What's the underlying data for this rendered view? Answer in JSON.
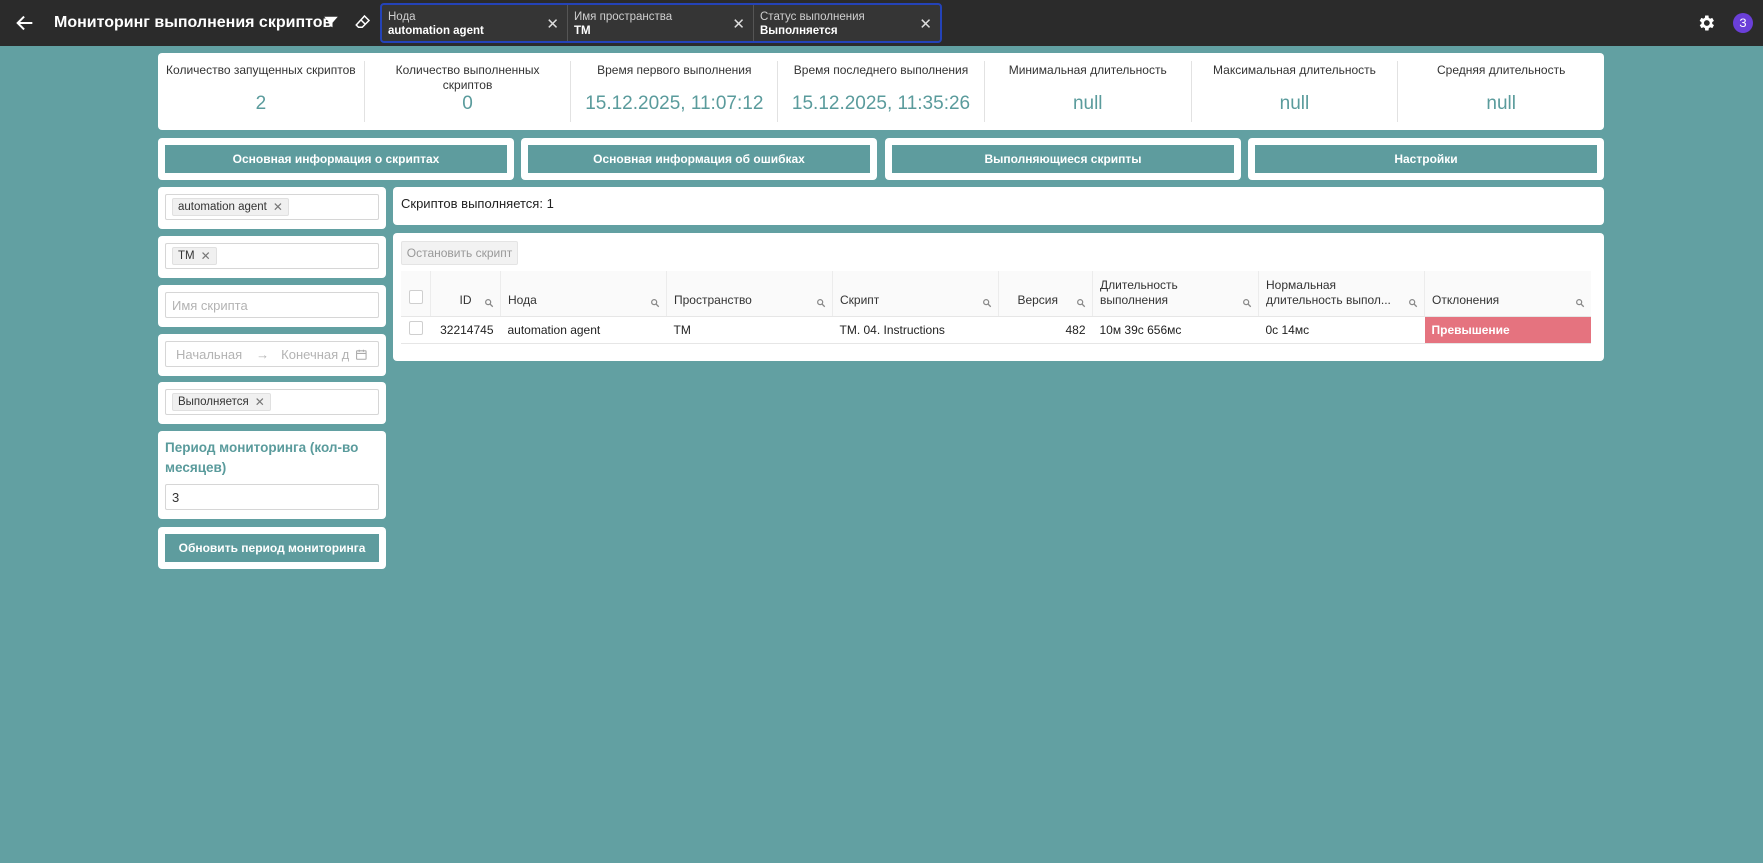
{
  "header": {
    "title": "Мониторинг выполнения скриптов",
    "filters": [
      {
        "label": "Нода",
        "value": "automation agent"
      },
      {
        "label": "Имя пространства",
        "value": "TM"
      },
      {
        "label": "Статус выполнения",
        "value": "Выполняется"
      }
    ],
    "avatar_letter": "З"
  },
  "stats": [
    {
      "label": "Количество запущенных скриптов",
      "value": "2"
    },
    {
      "label": "Количество выполненных скриптов",
      "value": "0"
    },
    {
      "label": "Время первого выполнения",
      "value": "15.12.2025, 11:07:12"
    },
    {
      "label": "Время последнего выполнения",
      "value": "15.12.2025, 11:35:26"
    },
    {
      "label": "Минимальная длительность",
      "value": "null"
    },
    {
      "label": "Максимальная длительность",
      "value": "null"
    },
    {
      "label": "Средняя длительность",
      "value": "null"
    }
  ],
  "tabs": [
    "Основная информация о скриптах",
    "Основная информация об ошибках",
    "Выполняющиеся скрипты",
    "Настройки"
  ],
  "left": {
    "node_tag": "automation agent",
    "space_tag": "TM",
    "script_placeholder": "Имя скрипта",
    "date_start_placeholder": "Начальная",
    "date_end_placeholder": "Конечная д",
    "date_arrow": "→",
    "status_tag": "Выполняется",
    "period_title": "Период мониторинга (кол-во месяцев)",
    "period_value": "3",
    "update_button": "Обновить период мониторинга"
  },
  "running_label": "Скриптов выполняется: 1",
  "stop_button": "Остановить скрипт",
  "table": {
    "headers": [
      "ID",
      "Нода",
      "Пространство",
      "Скрипт",
      "Версия",
      "Длительность выполнения",
      "Нормальная длительность выпол...",
      "Отклонения"
    ],
    "rows": [
      {
        "id": "32214745",
        "node": "automation agent",
        "space": "TM",
        "script": "TM. 04. Instructions",
        "version": "482",
        "duration": "10м 39с 656мс",
        "normal": "0с 14мс",
        "deviation": "Превышение"
      }
    ]
  },
  "colors": {
    "accent": "#5e9c9e",
    "background": "#62a0a2",
    "topbar": "#2b2b2b",
    "excess": "#e5737f",
    "chip_border": "#2443b8"
  }
}
